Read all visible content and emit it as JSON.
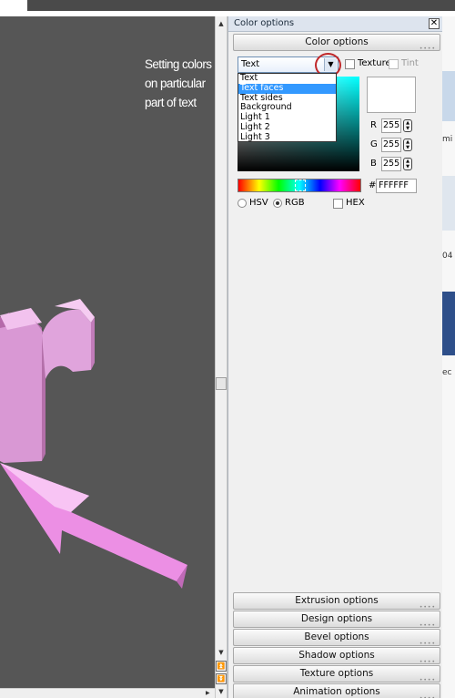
{
  "viewport": {
    "annotation_lines": [
      "Setting colors",
      "on particular",
      "part of text"
    ]
  },
  "panel": {
    "title": "Color options",
    "close_glyph": "✕",
    "top_section": "Color options",
    "select_value": "Text",
    "dropdown_options": [
      "Text",
      "Text faces",
      "Text sides",
      "Background",
      "Light 1",
      "Light 2",
      "Light 3"
    ],
    "selected_option": "Text faces",
    "texture_label": "Texture",
    "tint_label": "Tint",
    "rgb": [
      {
        "label": "R",
        "value": "255"
      },
      {
        "label": "G",
        "value": "255"
      },
      {
        "label": "B",
        "value": "255"
      }
    ],
    "hex_prefix": "#",
    "hex_value": "FFFFFF",
    "mode_hsv": "HSV",
    "mode_rgb": "RGB",
    "hex_label": "HEX",
    "bottom_sections": [
      "Extrusion options",
      "Design options",
      "Bevel options",
      "Shadow options",
      "Texture options",
      "Animation options"
    ]
  },
  "colors": {
    "viewport_bg": "#565656",
    "letter_pink": "#e89de0",
    "dropdown_highlight": "#3399ff",
    "annotation_circle": "#c0282a"
  },
  "edge_fragments": [
    "mi",
    "04",
    "ec"
  ]
}
